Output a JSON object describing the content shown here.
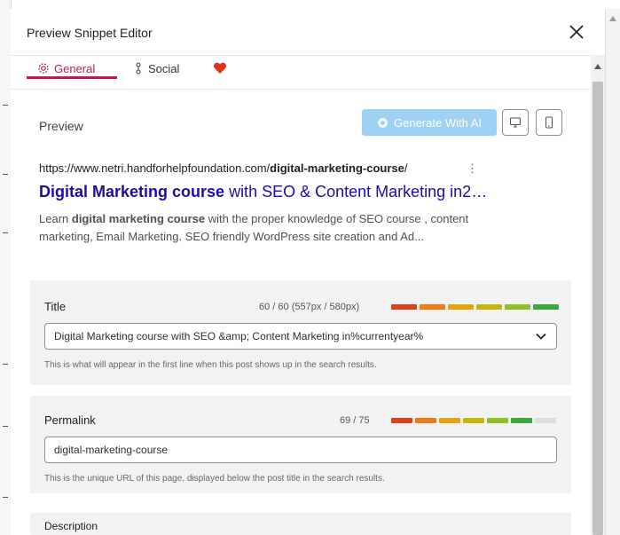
{
  "modal": {
    "title": "Preview Snippet Editor"
  },
  "tabs": [
    {
      "label": "General"
    },
    {
      "label": "Social"
    }
  ],
  "preview": {
    "label": "Preview",
    "ai_button": "Generate With AI",
    "url_prefix": "https://www.netri.handforhelpfoundation.com/",
    "url_slug": "digital-marketing-course",
    "url_suffix": "/",
    "dots": "⋮",
    "title_bold": "Digital Marketing course",
    "title_rest": " with SEO & Content Marketing in2…",
    "desc_line1_pre": "Learn ",
    "desc_line1_bold": "digital marketing course",
    "desc_line1_post": " with the proper knowledge of SEO course , content",
    "desc_line2": "marketing, Email Marketing. SEO friendly WordPress site creation and Ad..."
  },
  "title_field": {
    "label": "Title",
    "counter": "60 / 60 (557px / 580px)",
    "value": "Digital Marketing course with SEO &amp; Content Marketing in%currentyear%",
    "help": "This is what will appear in the first line when this post shows up in the search results.",
    "bar_colors": [
      "#e2401c",
      "#f07a13",
      "#e9a40c",
      "#c9b40d",
      "#8fbf26",
      "#3aa83a"
    ]
  },
  "permalink_field": {
    "label": "Permalink",
    "counter": "69 / 75",
    "value": "digital-marketing-course",
    "help": "This is the unique URL of this page, displayed below the post title in the search results.",
    "bar_colors": [
      "#e2401c",
      "#f07a13",
      "#e9a40c",
      "#c9b40d",
      "#8fbf26",
      "#3aa83a",
      "#dcdcdc"
    ]
  },
  "description_field": {
    "label": "Description"
  },
  "colors": {
    "accent": "#c2185b",
    "link": "#1a0dab",
    "ai_button": "#9fd1f5"
  }
}
